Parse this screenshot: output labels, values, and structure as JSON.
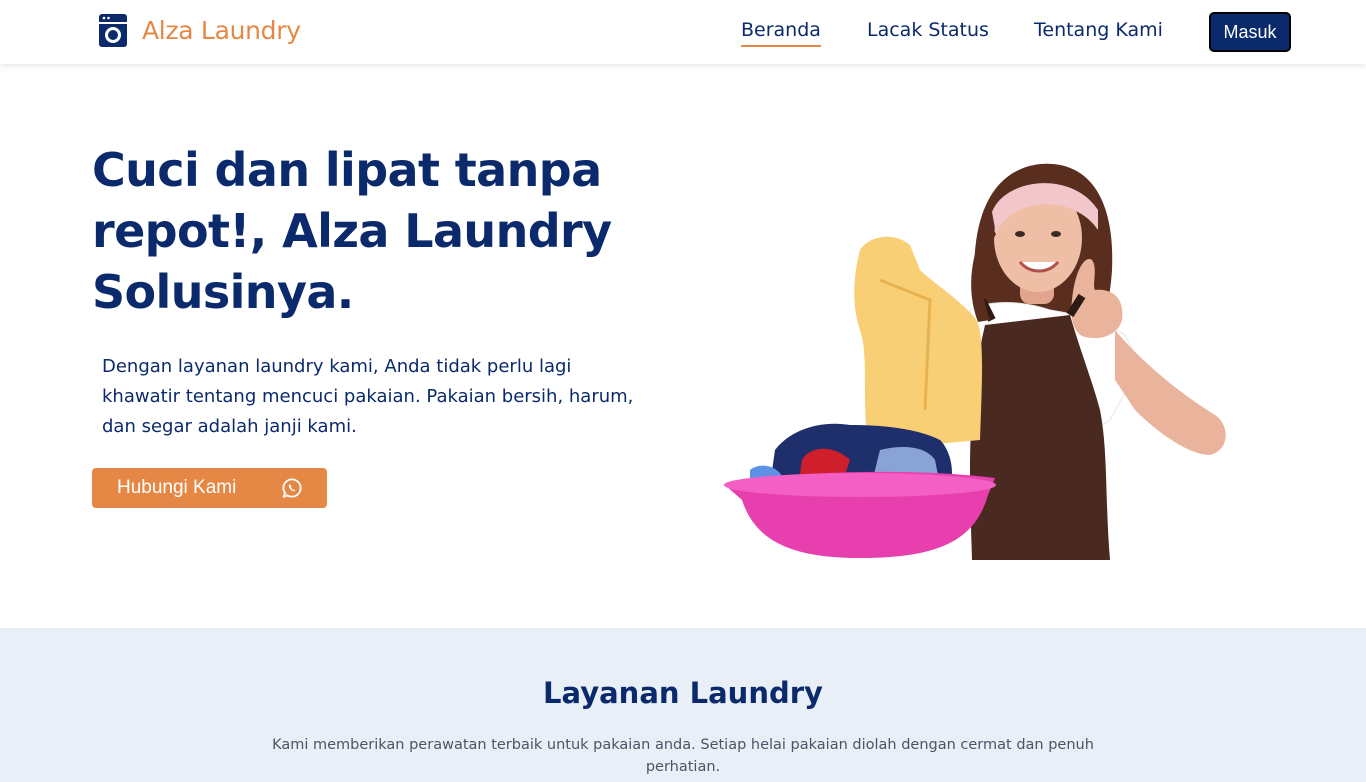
{
  "nav": {
    "brand": "Alza Laundry",
    "brand_icon": "washing-machine-icon",
    "links": [
      "Beranda",
      "Lacak Status",
      "Tentang Kami"
    ],
    "active": "Beranda",
    "login": "Masuk"
  },
  "hero": {
    "title": "Cuci dan lipat tanpa repot!, Alza Laundry Solusinya.",
    "text": "Dengan layanan laundry kami, Anda tidak perlu lagi khawatir tentang mencuci pakaian. Pakaian bersih, harum, dan segar adalah janji kami.",
    "cta": "Hubungi Kami",
    "cta_icon": "whatsapp-icon"
  },
  "services": {
    "title": "Layanan Laundry",
    "desc": "Kami memberikan perawatan terbaik untuk pakaian anda. Setiap helai pakaian diolah dengan cermat dan penuh perhatian."
  },
  "colors": {
    "primary": "#0b2a6b",
    "accent": "#e58845",
    "section_bg": "#e9eff6"
  }
}
